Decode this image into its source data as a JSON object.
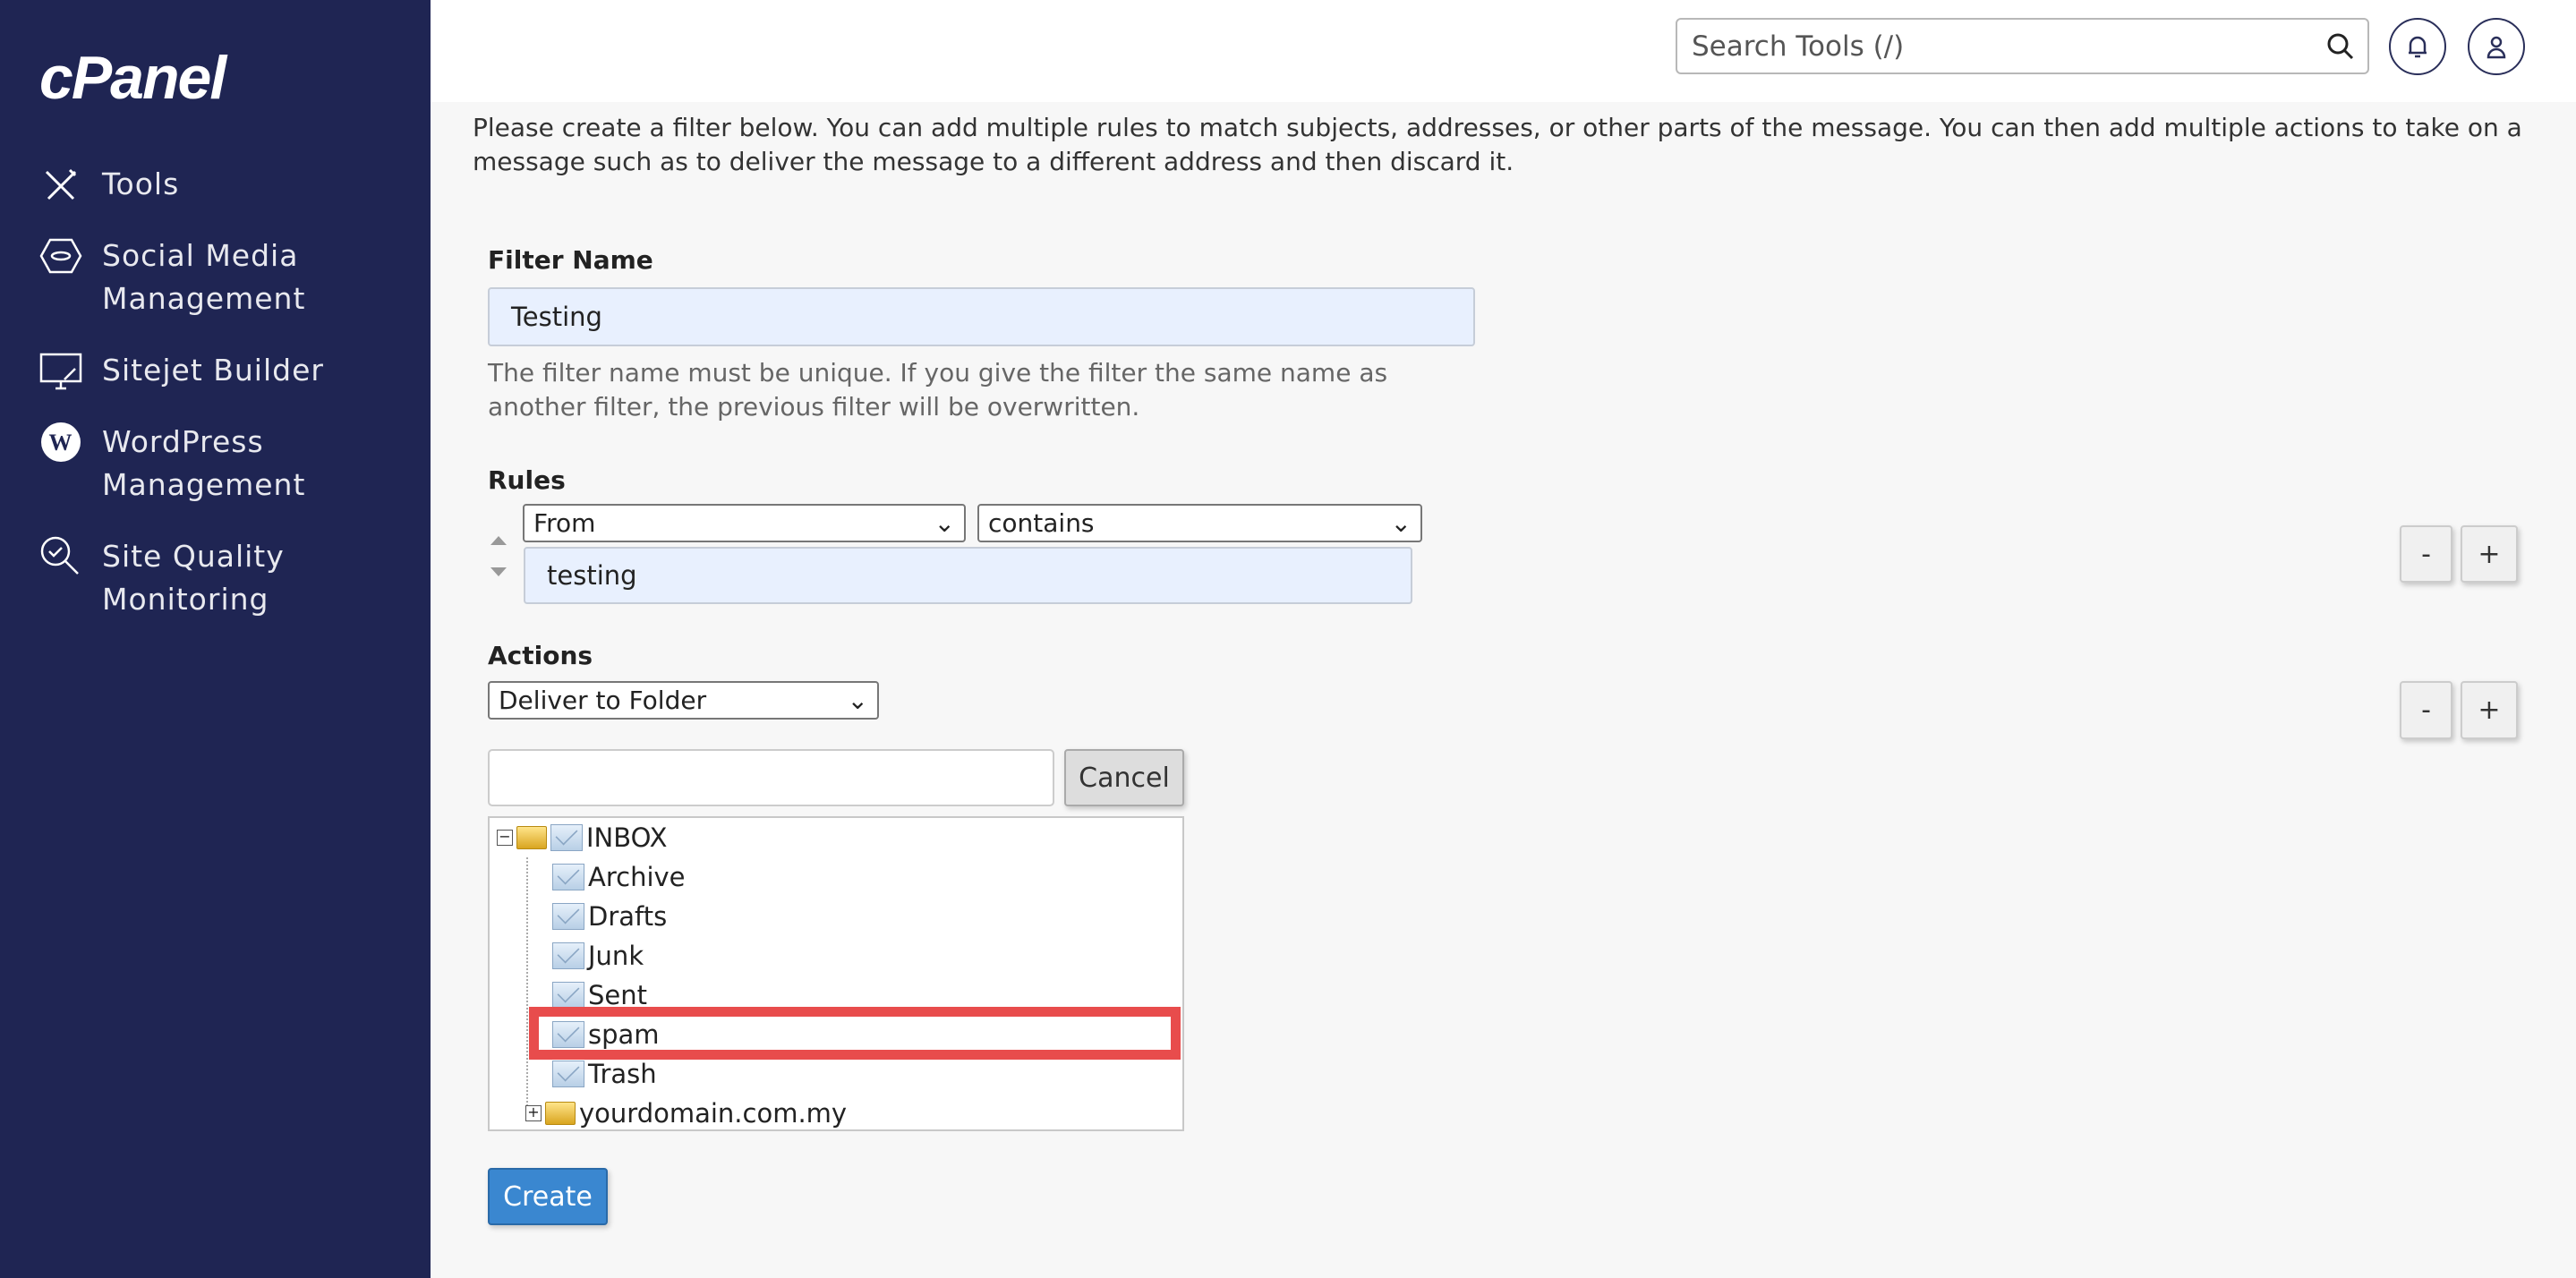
{
  "brand": "cPanel",
  "sidebar": {
    "items": [
      {
        "label_1": "Tools",
        "icon": "tools-icon"
      },
      {
        "label_1": "Social Media",
        "label_2": "Management",
        "icon": "social-media-icon"
      },
      {
        "label_1": "Sitejet Builder",
        "icon": "sitejet-icon"
      },
      {
        "label_1": "WordPress",
        "label_2": "Management",
        "icon": "wordpress-icon"
      },
      {
        "label_1": "Site Quality",
        "label_2": "Monitoring",
        "icon": "site-quality-icon"
      }
    ]
  },
  "header": {
    "search_placeholder": "Search Tools (/)"
  },
  "main": {
    "intro": "Please create a filter below. You can add multiple rules to match subjects, addresses, or other parts of the message. You can then add multiple actions to take on a message such as to deliver the message to a different address and then discard it.",
    "filter_name_label": "Filter Name",
    "filter_name_value": "Testing",
    "filter_help": "The filter name must be unique. If you give the filter the same name as another filter, the previous filter will be overwritten.",
    "rules_label": "Rules",
    "rule_field": "From",
    "rule_operator": "contains",
    "rule_value": "testing",
    "actions_label": "Actions",
    "action": "Deliver to Folder",
    "folder_input_value": "",
    "cancel": "Cancel",
    "minus": "-",
    "plus": "+",
    "create": "Create",
    "tree": {
      "root": "INBOX",
      "children": [
        "Archive",
        "Drafts",
        "Junk",
        "Sent",
        "spam",
        "Trash"
      ],
      "domain": "yourdomain.com.my",
      "highlighted": "spam"
    },
    "highlight_color": "#e84c4c"
  }
}
